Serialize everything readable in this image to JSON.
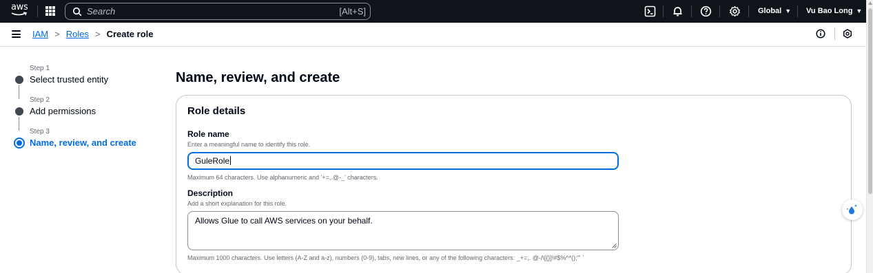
{
  "topnav": {
    "logo_text": "aws",
    "search_placeholder": "Search",
    "search_shortcut": "[Alt+S]",
    "region": "Global",
    "user": "Vu Bao Long",
    "icons": [
      "apps-grid-icon",
      "search-icon",
      "cloudshell-icon",
      "bell-icon",
      "help-icon",
      "settings-icon"
    ]
  },
  "breadcrumb": {
    "items": [
      "IAM",
      "Roles",
      "Create role"
    ]
  },
  "steps": [
    {
      "number": "Step 1",
      "title": "Select trusted entity"
    },
    {
      "number": "Step 2",
      "title": "Add permissions"
    },
    {
      "number": "Step 3",
      "title": "Name, review, and create"
    }
  ],
  "page": {
    "title": "Name, review, and create"
  },
  "role_details": {
    "title": "Role details",
    "role_name_label": "Role name",
    "role_name_description": "Enter a meaningful name to identify this role.",
    "role_name_value": "GuleRole",
    "role_name_constraint": "Maximum 64 characters. Use alphanumeric and '+=,.@-_' characters.",
    "description_label": "Description",
    "description_description": "Add a short explanation for this role.",
    "description_value": "Allows Glue to call AWS services on your behalf.",
    "description_constraint": "Maximum 1000 characters. Use letters (A-Z and a-z), numbers (0-9), tabs, new lines, or any of the following characters: _+=,. @-/\\[{}]!#$%^*();'\" `"
  },
  "colors": {
    "nav_bg": "#0f141a",
    "link": "#006ce0",
    "text": "#000716",
    "muted": "#656871"
  }
}
